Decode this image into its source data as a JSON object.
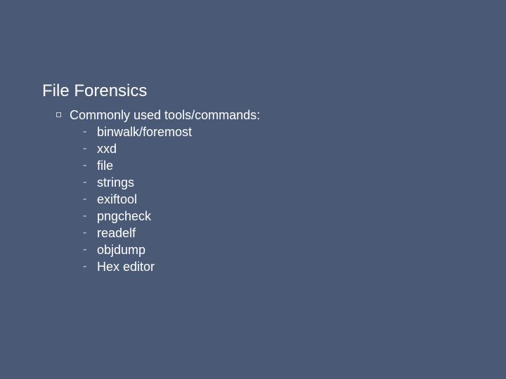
{
  "title": "File Forensics",
  "bullet": {
    "label": "Commonly used tools/commands:",
    "items": [
      "binwalk/foremost",
      "xxd",
      "file",
      "strings",
      "exiftool",
      "pngcheck",
      "readelf",
      "objdump",
      "Hex editor"
    ]
  }
}
